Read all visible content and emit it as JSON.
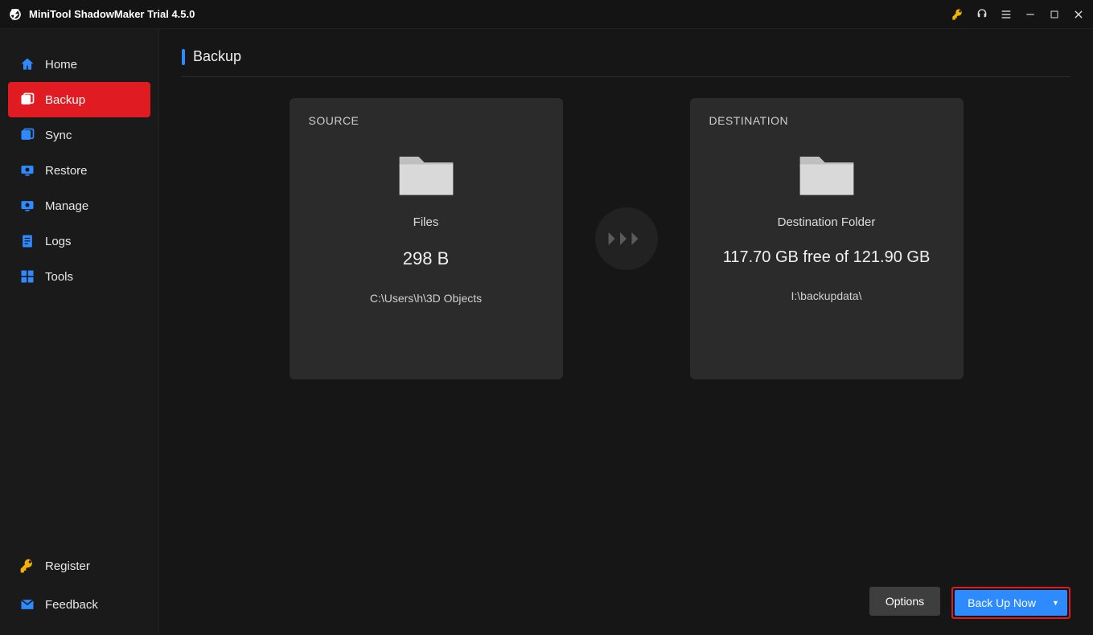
{
  "title": "MiniTool ShadowMaker Trial 4.5.0",
  "nav": {
    "home": "Home",
    "backup": "Backup",
    "sync": "Sync",
    "restore": "Restore",
    "manage": "Manage",
    "logs": "Logs",
    "tools": "Tools"
  },
  "bottomNav": {
    "register": "Register",
    "feedback": "Feedback"
  },
  "page": {
    "title": "Backup"
  },
  "source": {
    "label": "SOURCE",
    "typeLabel": "Files",
    "size": "298 B",
    "path": "C:\\Users\\h\\3D Objects"
  },
  "destination": {
    "label": "DESTINATION",
    "typeLabel": "Destination Folder",
    "capacity": "117.70 GB free of 121.90 GB",
    "path": "I:\\backupdata\\"
  },
  "actions": {
    "options": "Options",
    "backupNow": "Back Up Now"
  }
}
